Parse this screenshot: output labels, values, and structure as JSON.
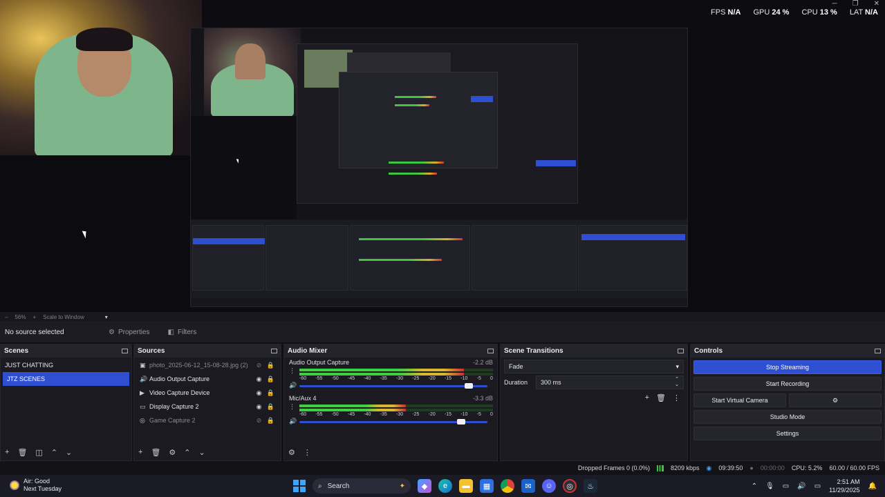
{
  "stats": {
    "fps_label": "FPS",
    "fps_value": "N/A",
    "gpu_label": "GPU",
    "gpu_value": "24 %",
    "cpu_label": "CPU",
    "cpu_value": "13 %",
    "lat_label": "LAT",
    "lat_value": "N/A"
  },
  "zoombar": {
    "minus": "–",
    "zoom": "56%",
    "plus": "+",
    "mode": "Scale to Window",
    "caret": "▾"
  },
  "sourcebar": {
    "status": "No source selected",
    "properties": "Properties",
    "filters": "Filters"
  },
  "scenes": {
    "title": "Scenes",
    "items": [
      {
        "label": "JUST CHATTING",
        "active": false
      },
      {
        "label": "JTZ SCENES",
        "active": true
      }
    ]
  },
  "sources": {
    "title": "Sources",
    "items": [
      {
        "label": "photo_2025-06-12_15-08-28.jpg (2)",
        "icon": "image-icon",
        "visible": false
      },
      {
        "label": "Audio Output Capture",
        "icon": "speaker-icon",
        "visible": true
      },
      {
        "label": "Video Capture Device",
        "icon": "camera-icon",
        "visible": true
      },
      {
        "label": "Display Capture 2",
        "icon": "monitor-icon",
        "visible": true
      },
      {
        "label": "Game Capture 2",
        "icon": "gamepad-icon",
        "visible": false
      }
    ]
  },
  "mixer": {
    "title": "Audio Mixer",
    "scale": [
      "-60",
      "-55",
      "-50",
      "-45",
      "-40",
      "-35",
      "-30",
      "-25",
      "-20",
      "-15",
      "-10",
      "-5",
      "0"
    ],
    "channels": [
      {
        "name": "Audio Output Capture",
        "db": "-2.2 dB",
        "level": 0.85,
        "volume": 0.9
      },
      {
        "name": "Mic/Aux 4",
        "db": "-3.3 dB",
        "level": 0.55,
        "volume": 0.86
      }
    ]
  },
  "transitions": {
    "title": "Scene Transitions",
    "selected": "Fade",
    "duration_label": "Duration",
    "duration_value": "300 ms"
  },
  "controls": {
    "title": "Controls",
    "stop_streaming": "Stop Streaming",
    "start_recording": "Start Recording",
    "start_virtual_camera": "Start Virtual Camera",
    "studio_mode": "Studio Mode",
    "settings": "Settings"
  },
  "statusbar": {
    "dropped": "Dropped Frames 0 (0.0%)",
    "bitrate": "8209 kbps",
    "stream_time": "09:39:50",
    "rec_time": "00:00:00",
    "cpu": "CPU: 5.2%",
    "fps": "60.00 / 60.00 FPS"
  },
  "taskbar": {
    "weather_line1": "Air: Good",
    "weather_line2": "Next Tuesday",
    "search": "Search",
    "time": "2:51 AM",
    "date": "11/29/2025"
  },
  "colors": {
    "accent": "#2e4fd1",
    "meter_green": "#3ed03e",
    "meter_yellow": "#d8b832",
    "meter_red": "#c63030"
  }
}
